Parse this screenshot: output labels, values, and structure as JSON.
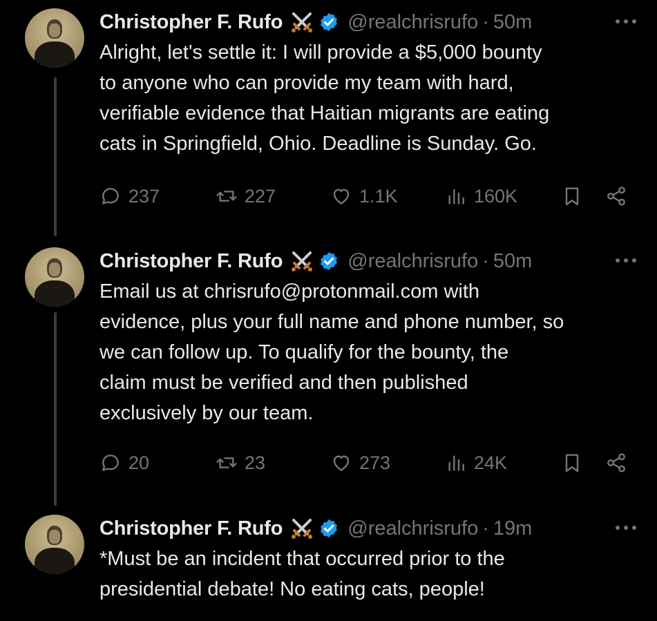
{
  "colors": {
    "background": "#000000",
    "text_primary": "#e7e9ea",
    "text_secondary": "#71767b",
    "verified_blue": "#1d9bf0",
    "thread_line": "#3a3d40"
  },
  "thread": {
    "tweets": [
      {
        "author_name": "Christopher F. Rufo",
        "name_emoji": "crossed-swords-icon",
        "verified": true,
        "handle": "@realchrisrufo",
        "separator": "·",
        "time": "50m",
        "text": "Alright, let's settle it: I will provide a $5,000 bounty\nto anyone who can provide my team with hard,\nverifiable evidence that Haitian migrants are eating\ncats in Springfield, Ohio. Deadline is Sunday. Go.",
        "actions": {
          "replies": "237",
          "reposts": "227",
          "likes": "1.1K",
          "views": "160K"
        }
      },
      {
        "author_name": "Christopher F. Rufo",
        "name_emoji": "crossed-swords-icon",
        "verified": true,
        "handle": "@realchrisrufo",
        "separator": "·",
        "time": "50m",
        "text": "Email us at chrisrufo@protonmail.com with\nevidence, plus your full name and phone number, so\nwe can follow up. To qualify for the bounty, the\nclaim must be verified and then published\nexclusively by our team.",
        "actions": {
          "replies": "20",
          "reposts": "23",
          "likes": "273",
          "views": "24K"
        }
      },
      {
        "author_name": "Christopher F. Rufo",
        "name_emoji": "crossed-swords-icon",
        "verified": true,
        "handle": "@realchrisrufo",
        "separator": "·",
        "time": "19m",
        "text": "*Must be an incident that occurred prior to the\npresidential debate! No eating cats, people!"
      }
    ]
  }
}
